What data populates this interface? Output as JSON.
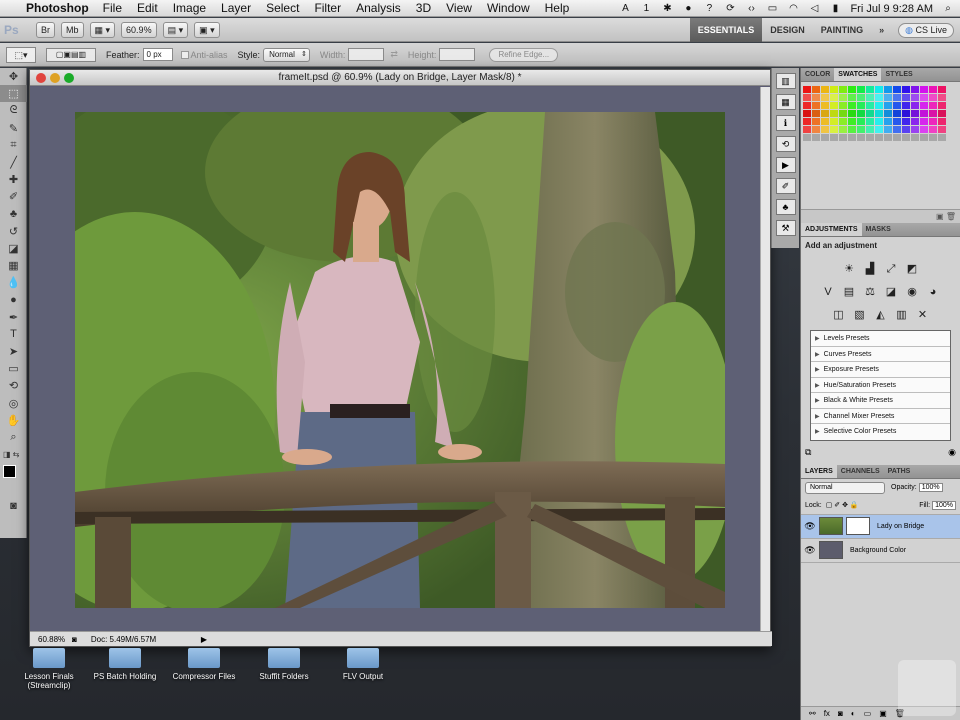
{
  "menubar": {
    "app": "Photoshop",
    "items": [
      "File",
      "Edit",
      "Image",
      "Layer",
      "Select",
      "Filter",
      "Analysis",
      "3D",
      "View",
      "Window",
      "Help"
    ],
    "badge": "1",
    "clock": "Fri Jul 9  9:28 AM"
  },
  "appbar": {
    "logo": "Ps",
    "zoom": "60.9%",
    "workspaces": [
      "ESSENTIALS",
      "DESIGN",
      "PAINTING",
      "»"
    ],
    "cs_live": "CS Live"
  },
  "options": {
    "feather_label": "Feather:",
    "feather_value": "0 px",
    "antialias": "Anti-alias",
    "style_label": "Style:",
    "style_value": "Normal",
    "width_label": "Width:",
    "height_label": "Height:",
    "refine": "Refine Edge..."
  },
  "document": {
    "title": "frameIt.psd @ 60.9% (Lady on Bridge, Layer Mask/8) *",
    "zoom": "60.88%",
    "doc_info": "Doc: 5.49M/6.57M"
  },
  "panels": {
    "color_tabs": [
      "COLOR",
      "SWATCHES",
      "STYLES"
    ],
    "adj_tabs": [
      "ADJUSTMENTS",
      "MASKS"
    ],
    "adj_label": "Add an adjustment",
    "presets": [
      "Levels Presets",
      "Curves Presets",
      "Exposure Presets",
      "Hue/Saturation Presets",
      "Black & White Presets",
      "Channel Mixer Presets",
      "Selective Color Presets"
    ],
    "layer_tabs": [
      "LAYERS",
      "CHANNELS",
      "PATHS"
    ],
    "blend": "Normal",
    "opacity_label": "Opacity:",
    "opacity": "100%",
    "lock_label": "Lock:",
    "fill_label": "Fill:",
    "fill": "100%",
    "layers": [
      "Lady on Bridge",
      "Background Color"
    ]
  },
  "desktop": {
    "icons": [
      "Lesson Finals (Streamclip)",
      "PS Batch Holding",
      "Compressor Files",
      "Stuffit Folders",
      "FLV Output"
    ]
  },
  "colors": {
    "accent": "#4a78c0",
    "canvas_bg": "#5e6075"
  }
}
